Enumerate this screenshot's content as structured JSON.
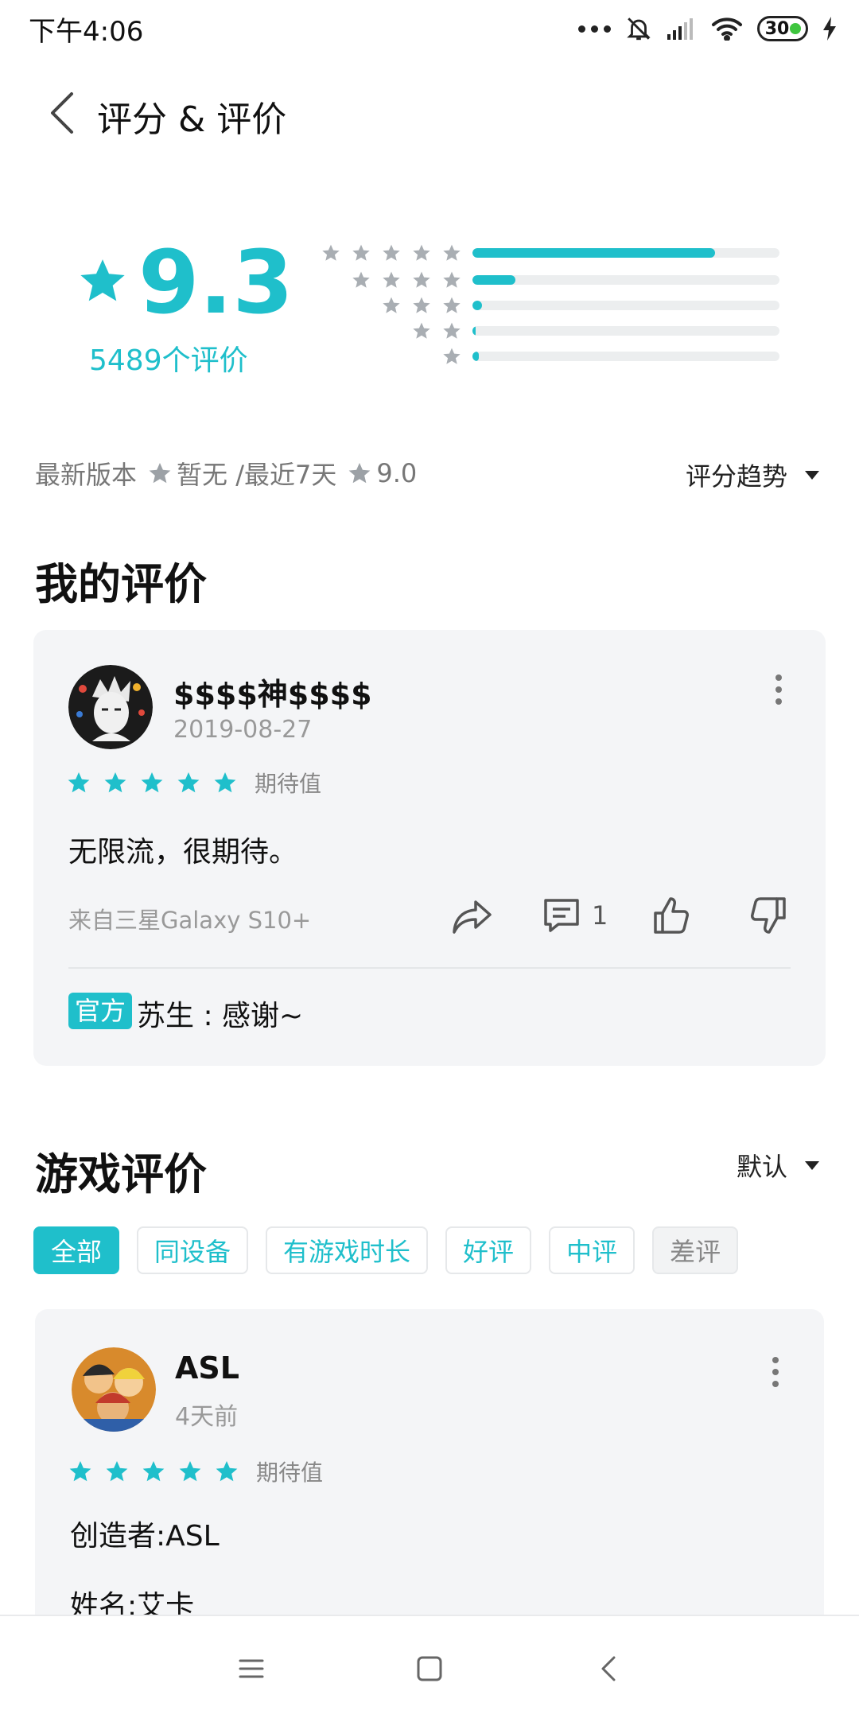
{
  "status_bar": {
    "time": "下午4:06",
    "battery": "30"
  },
  "header": {
    "title": "评分 & 评价"
  },
  "rating": {
    "score": "9.3",
    "count": "5489个评价",
    "distribution": [
      {
        "stars": 5,
        "fraction": 0.79
      },
      {
        "stars": 4,
        "fraction": 0.14
      },
      {
        "stars": 3,
        "fraction": 0.03
      },
      {
        "stars": 2,
        "fraction": 0.006
      },
      {
        "stars": 1,
        "fraction": 0.02
      }
    ]
  },
  "trend": {
    "latest_label": "最新版本",
    "latest_value": "暂无 /最近7天",
    "recent_value": "9.0",
    "trend_label": "评分趋势"
  },
  "my_review": {
    "section_title": "我的评价",
    "username": "$$$$神$$$$",
    "date": "2019-08-27",
    "stars": 5,
    "tag": "期待值",
    "text": "无限流，很期待。",
    "device": "来自三星Galaxy S10+",
    "comment_count": "1",
    "official_tag": "官方",
    "official_reply": "苏生 : 感谢~"
  },
  "game_reviews": {
    "section_title": "游戏评价",
    "sort": "默认",
    "filters": [
      "全部",
      "同设备",
      "有游戏时长",
      "好评",
      "中评",
      "差评"
    ],
    "first": {
      "username": "ASL",
      "date": "4天前",
      "stars": 5,
      "tag": "期待值",
      "line1": "创造者:ASL",
      "line2": "姓名:艾卡"
    }
  },
  "colors": {
    "accent": "#1fbfcb",
    "star_grey": "#a9aeb3"
  },
  "icons": [
    "back-icon",
    "star-icon",
    "share-icon",
    "comment-icon",
    "thumbs-up-icon",
    "thumbs-down-icon",
    "more-icon",
    "menu-icon",
    "home-icon"
  ]
}
